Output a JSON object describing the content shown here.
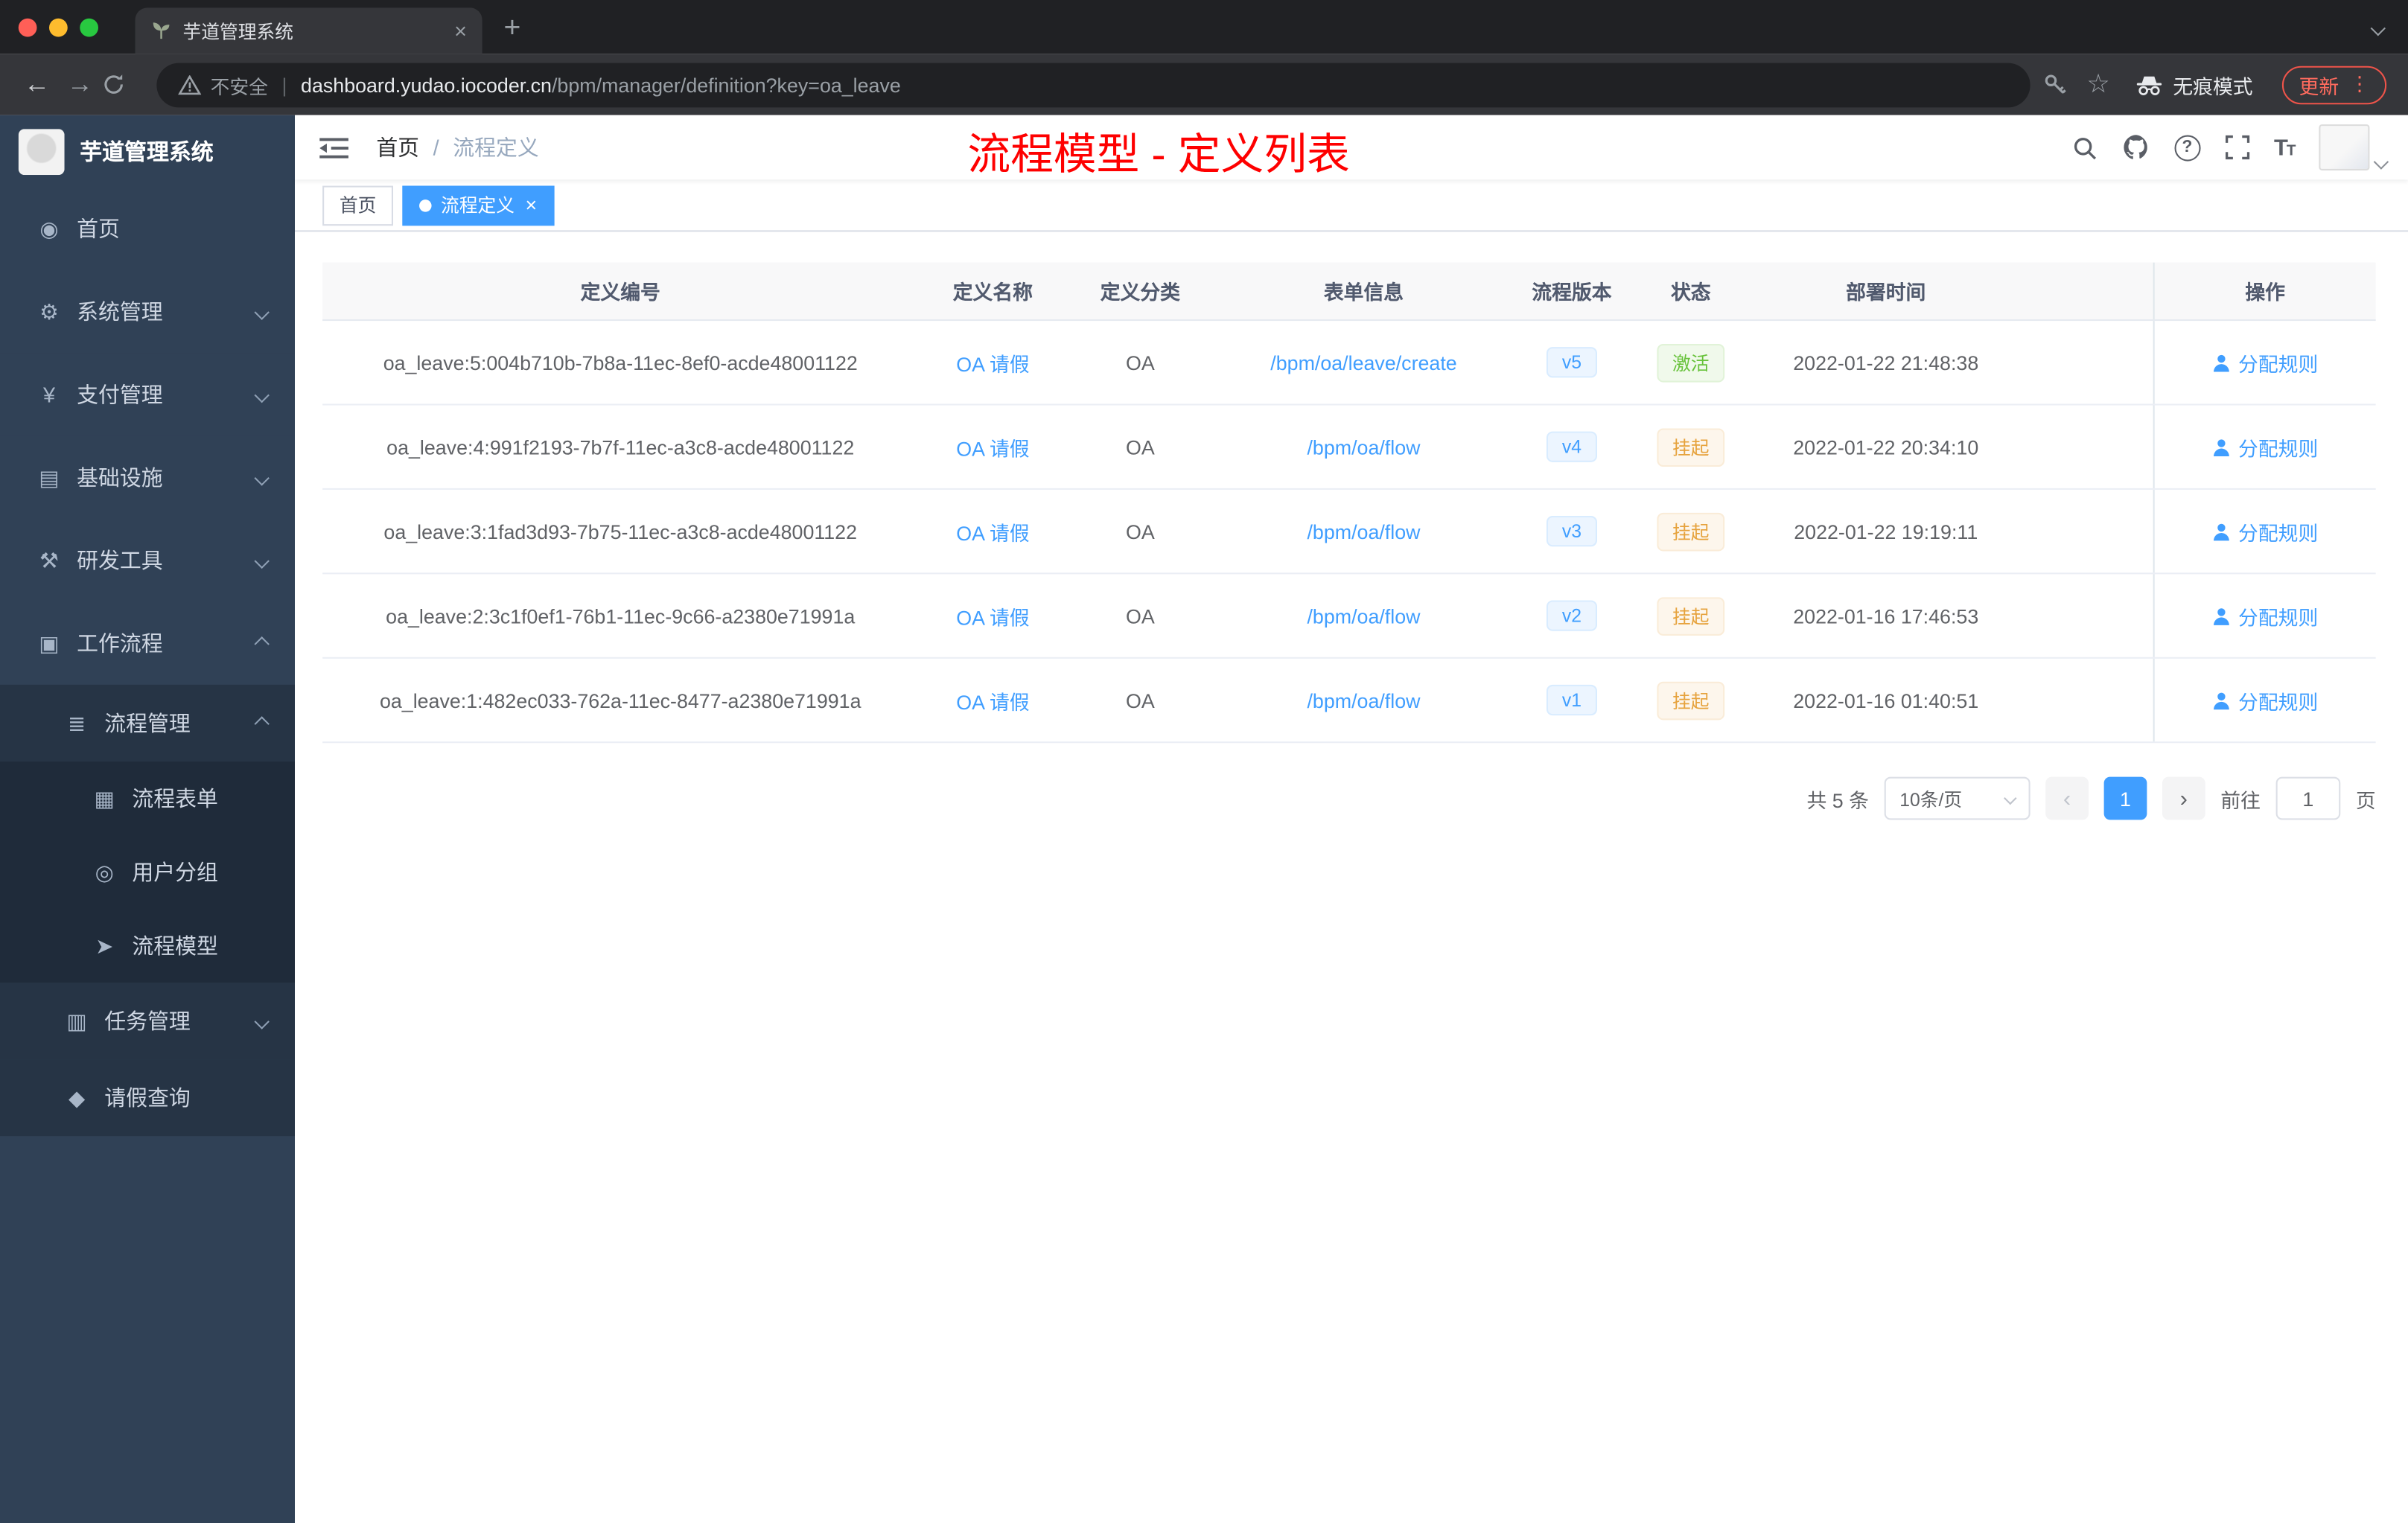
{
  "browser": {
    "tab_title": "芋道管理系统",
    "new_tab": "+",
    "close_tab": "×",
    "back": "←",
    "forward": "→",
    "security_label": "不安全",
    "url_sep": "|",
    "url_domain": "dashboard.yudao.iocoder.cn",
    "url_path": "/bpm/manager/definition?key=oa_leave",
    "star": "☆",
    "incognito_label": "无痕模式",
    "update_label": "更新",
    "menu_dots": "⋮"
  },
  "sidebar": {
    "logo_title": "芋道管理系统",
    "items": [
      {
        "name": "home",
        "label": "首页",
        "icon": "dashboard-icon",
        "glyph": "◉",
        "level": 1,
        "chevron": ""
      },
      {
        "name": "system-management",
        "label": "系统管理",
        "icon": "gear-icon",
        "glyph": "⚙",
        "level": 1,
        "chevron": "down"
      },
      {
        "name": "payment-management",
        "label": "支付管理",
        "icon": "yen-icon",
        "glyph": "¥",
        "level": 1,
        "chevron": "down"
      },
      {
        "name": "infrastructure",
        "label": "基础设施",
        "icon": "infrastructure-icon",
        "glyph": "▤",
        "level": 1,
        "chevron": "down"
      },
      {
        "name": "dev-tools",
        "label": "研发工具",
        "icon": "tools-icon",
        "glyph": "⚒",
        "level": 1,
        "chevron": "down"
      },
      {
        "name": "workflow",
        "label": "工作流程",
        "icon": "workflow-icon",
        "glyph": "▣",
        "level": 1,
        "chevron": "up"
      },
      {
        "name": "process-management",
        "label": "流程管理",
        "icon": "process-list-icon",
        "glyph": "≣",
        "level": 2,
        "chevron": "up"
      },
      {
        "name": "process-form",
        "label": "流程表单",
        "icon": "form-icon",
        "glyph": "▦",
        "level": 3,
        "chevron": ""
      },
      {
        "name": "user-group",
        "label": "用户分组",
        "icon": "user-group-icon",
        "glyph": "◎",
        "level": 3,
        "chevron": ""
      },
      {
        "name": "process-model",
        "label": "流程模型",
        "icon": "paper-plane-icon",
        "glyph": "➤",
        "level": 3,
        "chevron": ""
      },
      {
        "name": "task-management",
        "label": "任务管理",
        "icon": "task-icon",
        "glyph": "▥",
        "level": 2,
        "chevron": "down"
      },
      {
        "name": "leave-query",
        "label": "请假查询",
        "icon": "person-icon",
        "glyph": "◆",
        "level": 2,
        "chevron": ""
      }
    ]
  },
  "header": {
    "breadcrumb_home": "首页",
    "breadcrumb_sep": "/",
    "breadcrumb_current": "流程定义",
    "annotation": "流程模型 - 定义列表"
  },
  "tags": [
    {
      "name": "home",
      "label": "首页",
      "active": false
    },
    {
      "name": "process-definition",
      "label": "流程定义",
      "active": true
    }
  ],
  "table": {
    "columns": [
      "定义编号",
      "定义名称",
      "定义分类",
      "表单信息",
      "流程版本",
      "状态",
      "部署时间",
      "操作"
    ],
    "rows": [
      {
        "id": "oa_leave:5:004b710b-7b8a-11ec-8ef0-acde48001122",
        "name": "OA 请假",
        "category": "OA",
        "form": "/bpm/oa/leave/create",
        "version": "v5",
        "status": "激活",
        "status_type": "success",
        "time": "2022-01-22 21:48:38",
        "action": "分配规则"
      },
      {
        "id": "oa_leave:4:991f2193-7b7f-11ec-a3c8-acde48001122",
        "name": "OA 请假",
        "category": "OA",
        "form": "/bpm/oa/flow",
        "version": "v4",
        "status": "挂起",
        "status_type": "warning",
        "time": "2022-01-22 20:34:10",
        "action": "分配规则"
      },
      {
        "id": "oa_leave:3:1fad3d93-7b75-11ec-a3c8-acde48001122",
        "name": "OA 请假",
        "category": "OA",
        "form": "/bpm/oa/flow",
        "version": "v3",
        "status": "挂起",
        "status_type": "warning",
        "time": "2022-01-22 19:19:11",
        "action": "分配规则"
      },
      {
        "id": "oa_leave:2:3c1f0ef1-76b1-11ec-9c66-a2380e71991a",
        "name": "OA 请假",
        "category": "OA",
        "form": "/bpm/oa/flow",
        "version": "v2",
        "status": "挂起",
        "status_type": "warning",
        "time": "2022-01-16 17:46:53",
        "action": "分配规则"
      },
      {
        "id": "oa_leave:1:482ec033-762a-11ec-8477-a2380e71991a",
        "name": "OA 请假",
        "category": "OA",
        "form": "/bpm/oa/flow",
        "version": "v1",
        "status": "挂起",
        "status_type": "warning",
        "time": "2022-01-16 01:40:51",
        "action": "分配规则"
      }
    ]
  },
  "pagination": {
    "total": "共 5 条",
    "page_size": "10条/页",
    "prev": "‹",
    "next": "›",
    "current": "1",
    "goto_label": "前往",
    "goto_value": "1",
    "page_unit": "页"
  },
  "colors": {
    "accent": "#409eff",
    "success": "#67c23a",
    "warning": "#e6a23c",
    "annotation": "#fe0000",
    "sidebar_bg": "#304156"
  }
}
